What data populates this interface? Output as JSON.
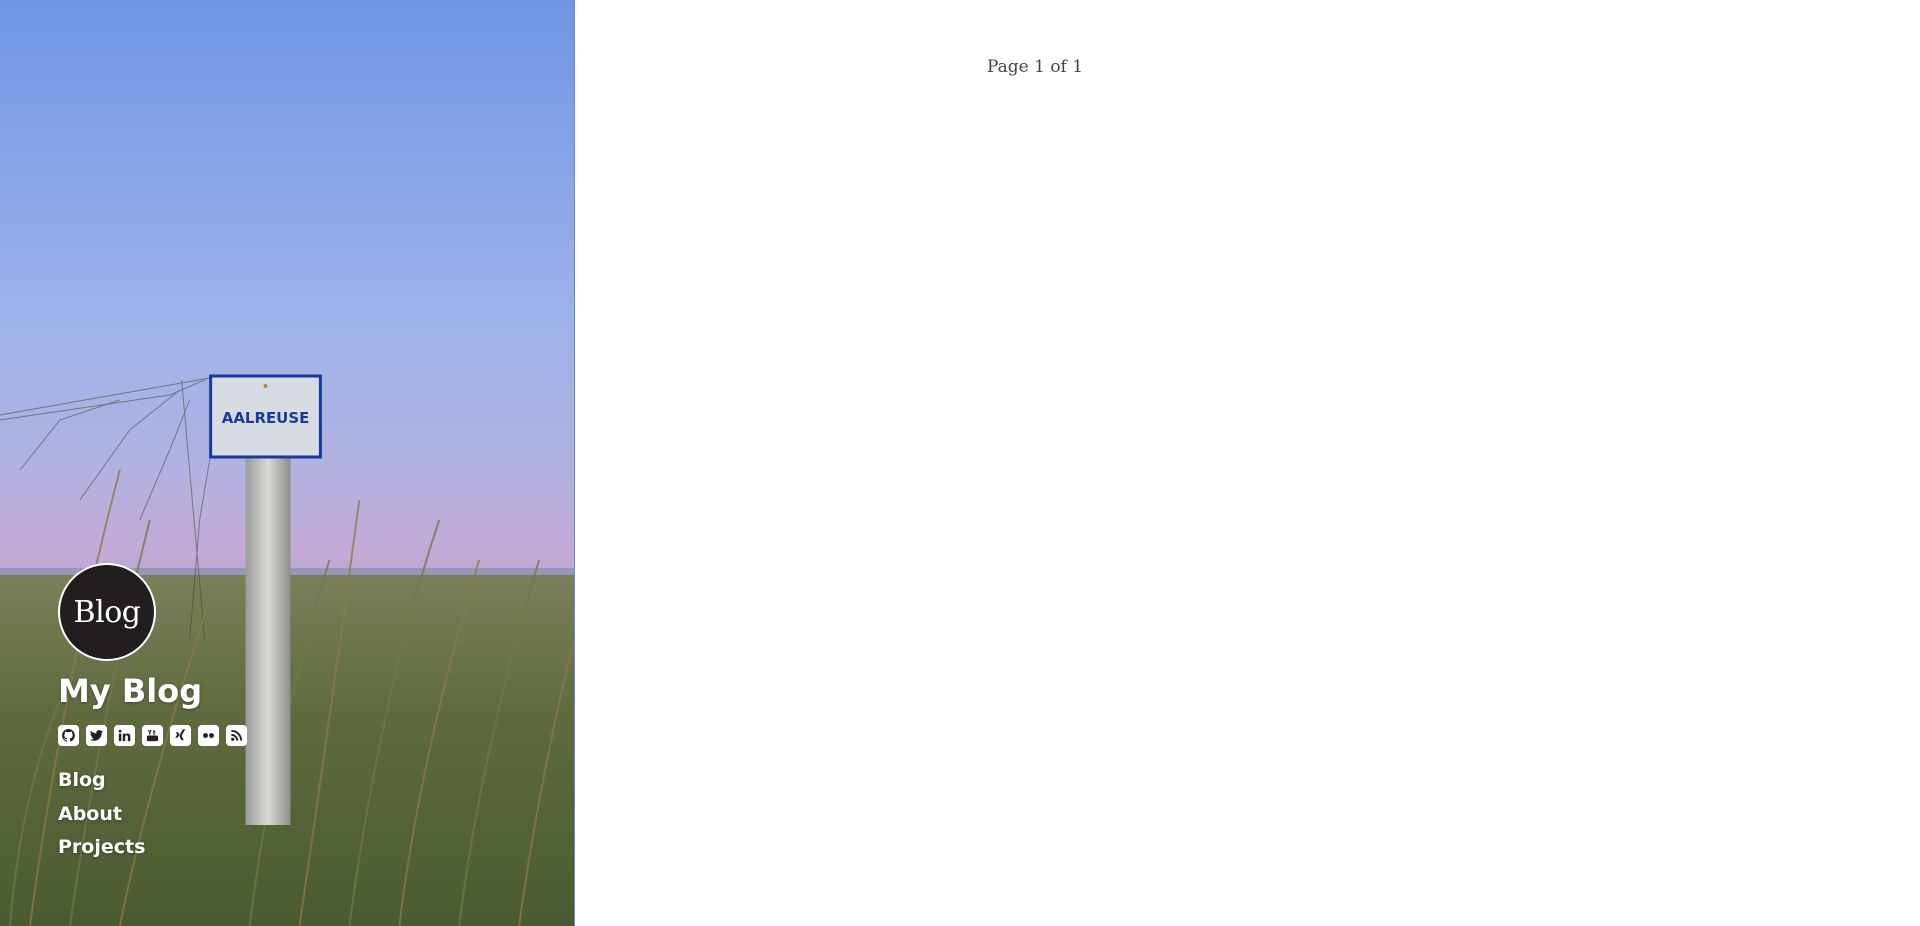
{
  "sidebar": {
    "avatar_text": "Blog",
    "site_title": "My Blog",
    "sign_text": "AALREUSE",
    "social_icons": [
      "github-icon",
      "twitter-icon",
      "linkedin-icon",
      "youtube-icon",
      "xing-icon",
      "flickr-icon",
      "rss-icon"
    ],
    "nav": [
      {
        "label": "Blog"
      },
      {
        "label": "About"
      },
      {
        "label": "Projects"
      }
    ]
  },
  "main": {
    "pagination": "Page 1 of 1"
  },
  "colors": {
    "sky_top": "#7297e3",
    "sky_bottom": "#b8a9d8",
    "sign_border": "#1a3a9a",
    "text_dark": "#444444"
  }
}
